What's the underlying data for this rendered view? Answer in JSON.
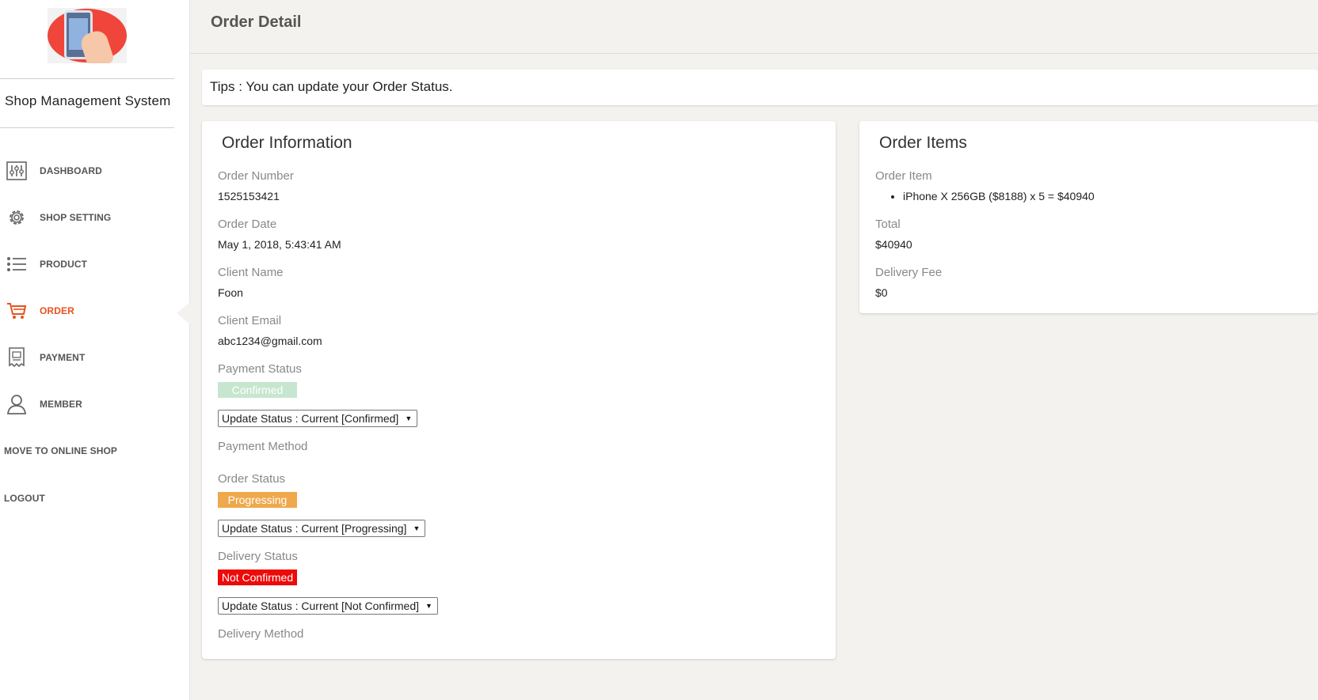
{
  "sidebar": {
    "brand": "Shop Management System",
    "items": [
      {
        "label": "DASHBOARD",
        "icon": "dashboard-sliders-icon"
      },
      {
        "label": "SHOP SETTING",
        "icon": "gear-icon"
      },
      {
        "label": "PRODUCT",
        "icon": "list-icon"
      },
      {
        "label": "ORDER",
        "icon": "shopping-cart-icon",
        "active": true
      },
      {
        "label": "PAYMENT",
        "icon": "receipt-icon"
      },
      {
        "label": "MEMBER",
        "icon": "user-icon"
      },
      {
        "label": "MOVE TO ONLINE SHOP"
      },
      {
        "label": "LOGOUT"
      }
    ]
  },
  "header": {
    "title": "Order Detail"
  },
  "tips": "Tips : You can update your Order Status.",
  "order_info": {
    "title": "Order Information",
    "order_number_label": "Order Number",
    "order_number": "1525153421",
    "order_date_label": "Order Date",
    "order_date": "May 1, 2018, 5:43:41 AM",
    "client_name_label": "Client Name",
    "client_name": "Foon",
    "client_email_label": "Client Email",
    "client_email": "abc1234@gmail.com",
    "payment_status_label": "Payment Status",
    "payment_status": "Confirmed",
    "payment_status_select": "Update Status : Current [Confirmed]",
    "payment_method_label": "Payment Method",
    "order_status_label": "Order Status",
    "order_status": "Progressing",
    "order_status_select": "Update Status : Current [Progressing]",
    "delivery_status_label": "Delivery Status",
    "delivery_status": "Not Confirmed",
    "delivery_status_select": "Update Status : Current [Not Confirmed]",
    "delivery_method_label": "Delivery Method"
  },
  "order_items": {
    "title": "Order Items",
    "item_label": "Order Item",
    "items": [
      "iPhone X 256GB ($8188) x 5 = $40940"
    ],
    "total_label": "Total",
    "total": "$40940",
    "delivery_fee_label": "Delivery Fee",
    "delivery_fee": "$0"
  },
  "colors": {
    "accent": "#e8521e",
    "confirmed": "#c7e6cf",
    "progressing": "#efa84b",
    "not_confirmed": "#ee0a0a"
  }
}
